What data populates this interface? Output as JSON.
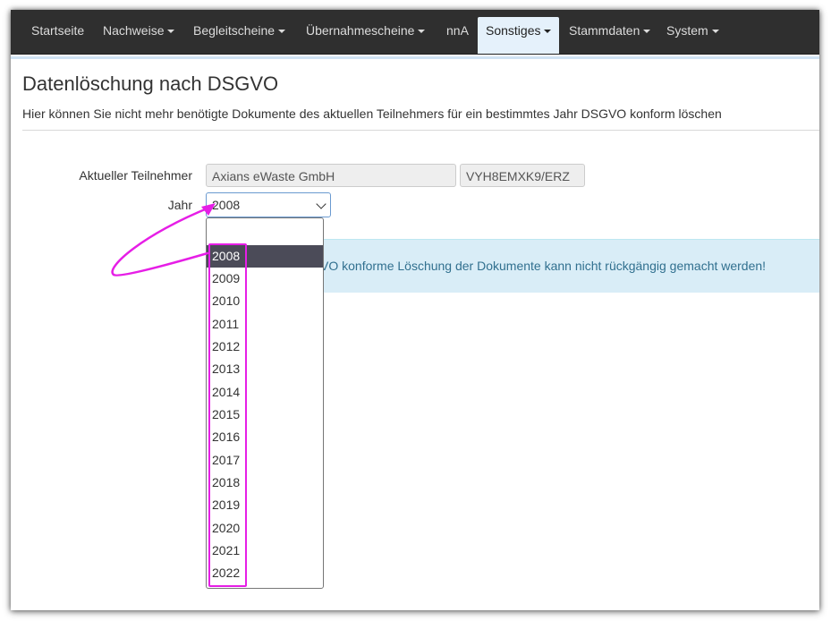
{
  "nav": {
    "items": [
      {
        "label": "Startseite",
        "dropdown": false,
        "active": false
      },
      {
        "label": "Nachweise",
        "dropdown": true,
        "active": false
      },
      {
        "label": "Begleitscheine",
        "dropdown": true,
        "active": false
      },
      {
        "label": "Übernahmescheine",
        "dropdown": true,
        "active": false
      },
      {
        "label": "nnA",
        "dropdown": false,
        "active": false
      },
      {
        "label": "Sonstiges",
        "dropdown": true,
        "active": true
      },
      {
        "label": "Stammdaten",
        "dropdown": true,
        "active": false
      },
      {
        "label": "System",
        "dropdown": true,
        "active": false
      }
    ]
  },
  "page": {
    "title": "Datenlöschung nach DSGVO",
    "description": "Hier können Sie nicht mehr benötigte Dokumente des aktuellen Teilnehmers für ein bestimmtes Jahr DSGVO konform löschen"
  },
  "form": {
    "participant_label": "Aktueller Teilnehmer",
    "participant_name": "Axians eWaste GmbH",
    "participant_id": "VYH8EMXK9/ERZ",
    "year_label": "Jahr",
    "year_value": "2008",
    "year_options": [
      "",
      "2008",
      "2009",
      "2010",
      "2011",
      "2012",
      "2013",
      "2014",
      "2015",
      "2016",
      "2017",
      "2018",
      "2019",
      "2020",
      "2021",
      "2022"
    ],
    "selected_option": "2008"
  },
  "alert": {
    "text": "VO konforme Löschung der Dokumente kann nicht rückgängig gemacht werden!"
  },
  "colors": {
    "navbar": "#2f2f2f",
    "active_tab": "#e5f1fb",
    "alert_bg": "#d9edf7",
    "alert_text": "#31708f",
    "annotation": "#e61ee6",
    "selected_option_bg": "#4b4b58"
  }
}
